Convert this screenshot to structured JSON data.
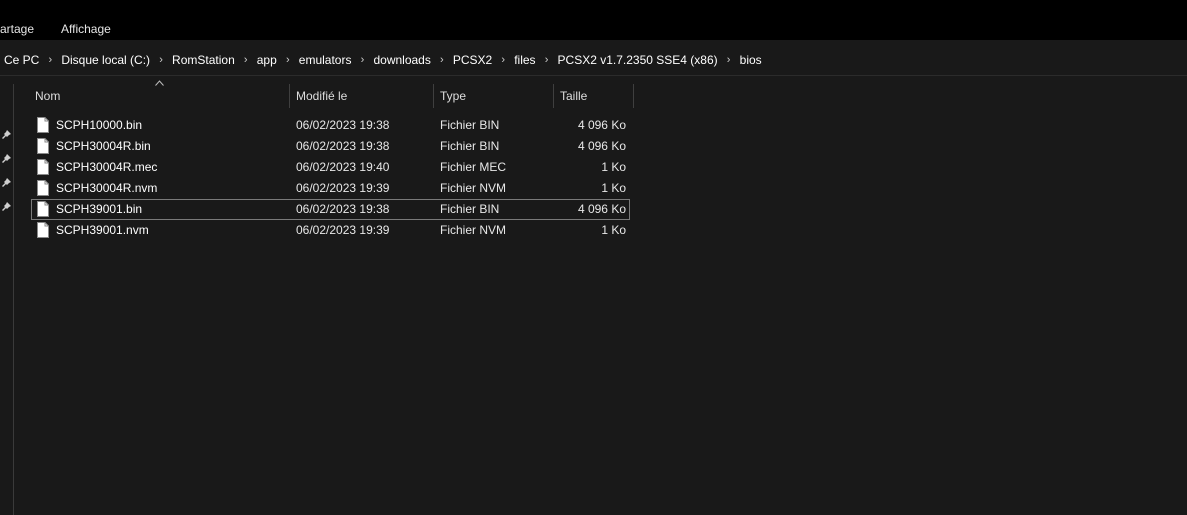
{
  "ribbon": {
    "tabs": [
      "artage",
      "Affichage"
    ]
  },
  "address": {
    "crumbs": [
      "Ce PC",
      "Disque local (C:)",
      "RomStation",
      "app",
      "emulators",
      "downloads",
      "PCSX2",
      "files",
      "PCSX2 v1.7.2350 SSE4 (x86)",
      "bios"
    ]
  },
  "columns": {
    "name": "Nom",
    "modified": "Modifié le",
    "type": "Type",
    "size": "Taille"
  },
  "files": [
    {
      "name": "SCPH10000.bin",
      "modified": "06/02/2023 19:38",
      "type": "Fichier BIN",
      "size": "4 096 Ko"
    },
    {
      "name": "SCPH30004R.bin",
      "modified": "06/02/2023 19:38",
      "type": "Fichier BIN",
      "size": "4 096 Ko"
    },
    {
      "name": "SCPH30004R.mec",
      "modified": "06/02/2023 19:40",
      "type": "Fichier MEC",
      "size": "1 Ko"
    },
    {
      "name": "SCPH30004R.nvm",
      "modified": "06/02/2023 19:39",
      "type": "Fichier NVM",
      "size": "1 Ko"
    },
    {
      "name": "SCPH39001.bin",
      "modified": "06/02/2023 19:38",
      "type": "Fichier BIN",
      "size": "4 096 Ko"
    },
    {
      "name": "SCPH39001.nvm",
      "modified": "06/02/2023 19:39",
      "type": "Fichier NVM",
      "size": "1 Ko"
    }
  ],
  "focused_row": 4,
  "icons": {
    "pin": "pin-icon",
    "file": "file-icon",
    "separator": "chevron-right-icon",
    "sort": "sort-ascending-icon"
  },
  "colors": {
    "background": "#191919",
    "ribbon": "#000000",
    "focus_outline": "#7a7a7a"
  }
}
